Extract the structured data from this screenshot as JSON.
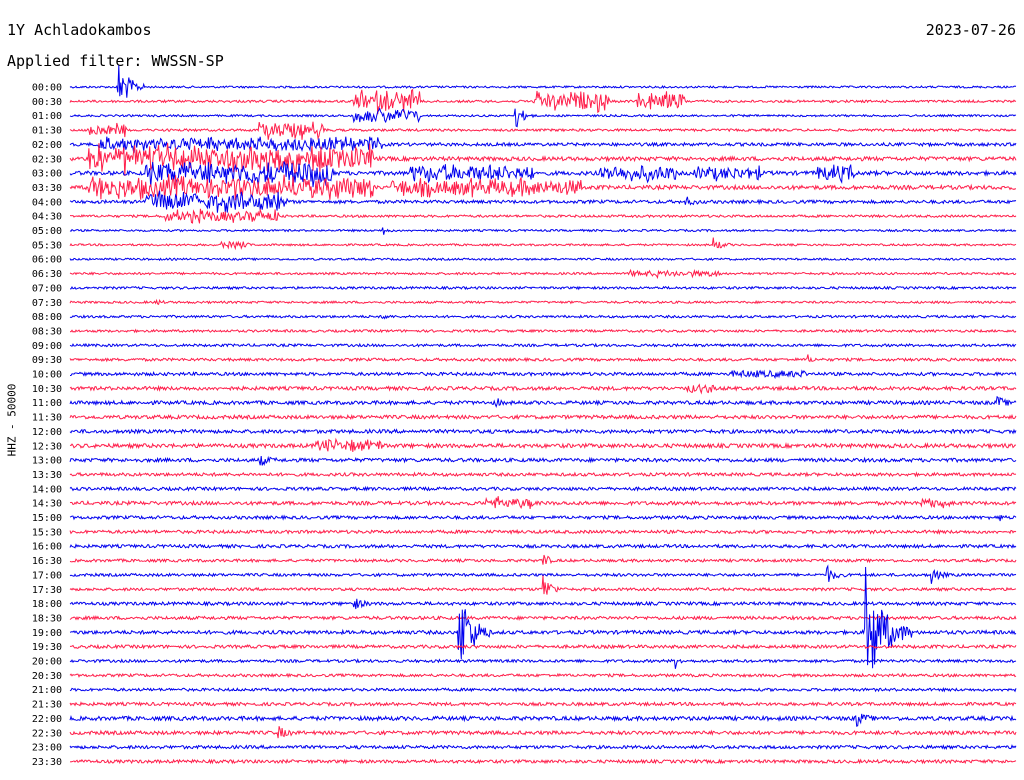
{
  "header": {
    "station": "1Y Achladokambos",
    "date": "2023-07-26",
    "filter_label": "Applied filter: WWSSN-SP"
  },
  "chart_data": {
    "type": "line",
    "title": "1Y Achladokambos",
    "ylabel": "HHZ - 50000",
    "trace_colors": [
      "#0000ee",
      "#ff1f4b"
    ],
    "background": "#ffffff",
    "rows": [
      {
        "label": "00:00",
        "amplitude": 1.0,
        "events": [
          {
            "pos": 0.05,
            "amp": 30,
            "dur": 0.03,
            "type": "burst"
          }
        ]
      },
      {
        "label": "00:30",
        "amplitude": 1.2,
        "events": [
          {
            "pos": 0.3,
            "amp": 14,
            "dur": 0.07,
            "type": "noise"
          },
          {
            "pos": 0.49,
            "amp": 12,
            "dur": 0.08,
            "type": "noise"
          },
          {
            "pos": 0.6,
            "amp": 12,
            "dur": 0.05,
            "type": "noise"
          }
        ]
      },
      {
        "label": "01:00",
        "amplitude": 1.0,
        "events": [
          {
            "pos": 0.3,
            "amp": 9,
            "dur": 0.07,
            "type": "noise"
          },
          {
            "pos": 0.47,
            "amp": 16,
            "dur": 0.02,
            "type": "burst"
          }
        ]
      },
      {
        "label": "01:30",
        "amplitude": 1.2,
        "events": [
          {
            "pos": 0.02,
            "amp": 8,
            "dur": 0.04,
            "type": "noise"
          },
          {
            "pos": 0.2,
            "amp": 10,
            "dur": 0.07,
            "type": "noise"
          }
        ]
      },
      {
        "label": "02:00",
        "amplitude": 1.6,
        "events": [
          {
            "pos": 0.03,
            "amp": 8,
            "dur": 0.3,
            "type": "noise"
          }
        ]
      },
      {
        "label": "02:30",
        "amplitude": 2.0,
        "events": [
          {
            "pos": 0.02,
            "amp": 16,
            "dur": 0.3,
            "type": "noise"
          }
        ]
      },
      {
        "label": "03:00",
        "amplitude": 2.0,
        "events": [
          {
            "pos": 0.08,
            "amp": 16,
            "dur": 0.2,
            "type": "noise"
          },
          {
            "pos": 0.36,
            "amp": 10,
            "dur": 0.13,
            "type": "noise"
          },
          {
            "pos": 0.56,
            "amp": 9,
            "dur": 0.08,
            "type": "noise"
          },
          {
            "pos": 0.66,
            "amp": 7,
            "dur": 0.07,
            "type": "noise"
          },
          {
            "pos": 0.79,
            "amp": 9,
            "dur": 0.04,
            "type": "noise"
          }
        ]
      },
      {
        "label": "03:30",
        "amplitude": 2.0,
        "events": [
          {
            "pos": 0.02,
            "amp": 14,
            "dur": 0.3,
            "type": "noise"
          },
          {
            "pos": 0.34,
            "amp": 10,
            "dur": 0.2,
            "type": "noise"
          }
        ]
      },
      {
        "label": "04:00",
        "amplitude": 1.6,
        "events": [
          {
            "pos": 0.08,
            "amp": 12,
            "dur": 0.15,
            "type": "noise"
          },
          {
            "pos": 0.65,
            "amp": 5,
            "dur": 0.02,
            "type": "burst"
          }
        ]
      },
      {
        "label": "04:30",
        "amplitude": 1.2,
        "events": [
          {
            "pos": 0.1,
            "amp": 7,
            "dur": 0.12,
            "type": "noise"
          }
        ]
      },
      {
        "label": "05:00",
        "amplitude": 1.0,
        "events": [
          {
            "pos": 0.33,
            "amp": 6,
            "dur": 0.01,
            "type": "burst"
          }
        ]
      },
      {
        "label": "05:30",
        "amplitude": 1.0,
        "events": [
          {
            "pos": 0.16,
            "amp": 4,
            "dur": 0.03,
            "type": "noise"
          },
          {
            "pos": 0.68,
            "amp": 7,
            "dur": 0.02,
            "type": "burst"
          }
        ]
      },
      {
        "label": "06:00",
        "amplitude": 1.0,
        "events": []
      },
      {
        "label": "06:30",
        "amplitude": 1.1,
        "events": [
          {
            "pos": 0.59,
            "amp": 3,
            "dur": 0.1,
            "type": "noise"
          }
        ]
      },
      {
        "label": "07:00",
        "amplitude": 1.2,
        "events": []
      },
      {
        "label": "07:30",
        "amplitude": 1.1,
        "events": [
          {
            "pos": 0.09,
            "amp": 6,
            "dur": 0.01,
            "type": "burst"
          }
        ]
      },
      {
        "label": "08:00",
        "amplitude": 1.2,
        "events": [
          {
            "pos": 0.33,
            "amp": 5,
            "dur": 0.01,
            "type": "burst"
          }
        ]
      },
      {
        "label": "08:30",
        "amplitude": 1.2,
        "events": []
      },
      {
        "label": "09:00",
        "amplitude": 1.3,
        "events": []
      },
      {
        "label": "09:30",
        "amplitude": 1.4,
        "events": [
          {
            "pos": 0.78,
            "amp": 4,
            "dur": 0.01,
            "type": "burst"
          }
        ]
      },
      {
        "label": "10:00",
        "amplitude": 1.6,
        "events": [
          {
            "pos": 0.7,
            "amp": 3,
            "dur": 0.08,
            "type": "noise"
          }
        ]
      },
      {
        "label": "10:30",
        "amplitude": 1.8,
        "events": [
          {
            "pos": 0.65,
            "amp": 4,
            "dur": 0.03,
            "type": "noise"
          }
        ]
      },
      {
        "label": "11:00",
        "amplitude": 1.8,
        "events": [
          {
            "pos": 0.45,
            "amp": 6,
            "dur": 0.01,
            "type": "burst"
          },
          {
            "pos": 0.98,
            "amp": 6,
            "dur": 0.02,
            "type": "burst"
          }
        ]
      },
      {
        "label": "11:30",
        "amplitude": 1.8,
        "events": []
      },
      {
        "label": "12:00",
        "amplitude": 1.8,
        "events": []
      },
      {
        "label": "12:30",
        "amplitude": 2.0,
        "events": [
          {
            "pos": 0.26,
            "amp": 6,
            "dur": 0.07,
            "type": "noise"
          }
        ]
      },
      {
        "label": "13:00",
        "amplitude": 1.8,
        "events": [
          {
            "pos": 0.2,
            "amp": 6,
            "dur": 0.02,
            "type": "burst"
          }
        ]
      },
      {
        "label": "13:30",
        "amplitude": 1.6,
        "events": []
      },
      {
        "label": "14:00",
        "amplitude": 1.6,
        "events": []
      },
      {
        "label": "14:30",
        "amplitude": 1.8,
        "events": [
          {
            "pos": 0.44,
            "amp": 6,
            "dur": 0.05,
            "type": "noise"
          },
          {
            "pos": 0.9,
            "amp": 5,
            "dur": 0.03,
            "type": "noise"
          }
        ]
      },
      {
        "label": "15:00",
        "amplitude": 1.6,
        "events": [
          {
            "pos": 0.98,
            "amp": 6,
            "dur": 0.01,
            "type": "burst"
          }
        ]
      },
      {
        "label": "15:30",
        "amplitude": 1.6,
        "events": []
      },
      {
        "label": "16:00",
        "amplitude": 1.6,
        "events": []
      },
      {
        "label": "16:30",
        "amplitude": 1.4,
        "events": [
          {
            "pos": 0.5,
            "amp": 14,
            "dur": 0.01,
            "type": "burst"
          }
        ]
      },
      {
        "label": "17:00",
        "amplitude": 1.4,
        "events": [
          {
            "pos": 0.8,
            "amp": 9,
            "dur": 0.02,
            "type": "burst"
          },
          {
            "pos": 0.91,
            "amp": 9,
            "dur": 0.02,
            "type": "burst"
          }
        ]
      },
      {
        "label": "17:30",
        "amplitude": 1.4,
        "events": [
          {
            "pos": 0.5,
            "amp": 16,
            "dur": 0.02,
            "type": "burst"
          }
        ]
      },
      {
        "label": "18:00",
        "amplitude": 1.6,
        "events": [
          {
            "pos": 0.3,
            "amp": 6,
            "dur": 0.02,
            "type": "burst"
          }
        ]
      },
      {
        "label": "18:30",
        "amplitude": 1.6,
        "events": []
      },
      {
        "label": "19:00",
        "amplitude": 1.8,
        "events": [
          {
            "pos": 0.41,
            "amp": 55,
            "dur": 0.035,
            "type": "burst"
          },
          {
            "pos": 0.84,
            "amp": 70,
            "dur": 0.05,
            "type": "burst"
          }
        ]
      },
      {
        "label": "19:30",
        "amplitude": 1.6,
        "events": []
      },
      {
        "label": "20:00",
        "amplitude": 1.4,
        "events": [
          {
            "pos": 0.64,
            "amp": 7,
            "dur": 0.01,
            "type": "burst"
          }
        ]
      },
      {
        "label": "20:30",
        "amplitude": 1.4,
        "events": []
      },
      {
        "label": "21:00",
        "amplitude": 1.4,
        "events": [
          {
            "pos": 0.99,
            "amp": 6,
            "dur": 0.01,
            "type": "burst"
          }
        ]
      },
      {
        "label": "21:30",
        "amplitude": 1.6,
        "events": []
      },
      {
        "label": "22:00",
        "amplitude": 2.0,
        "events": [
          {
            "pos": 0.83,
            "amp": 9,
            "dur": 0.02,
            "type": "burst"
          }
        ]
      },
      {
        "label": "22:30",
        "amplitude": 1.8,
        "events": [
          {
            "pos": 0.22,
            "amp": 6,
            "dur": 0.02,
            "type": "burst"
          }
        ]
      },
      {
        "label": "23:00",
        "amplitude": 1.6,
        "events": []
      },
      {
        "label": "23:30",
        "amplitude": 1.6,
        "events": []
      }
    ]
  }
}
